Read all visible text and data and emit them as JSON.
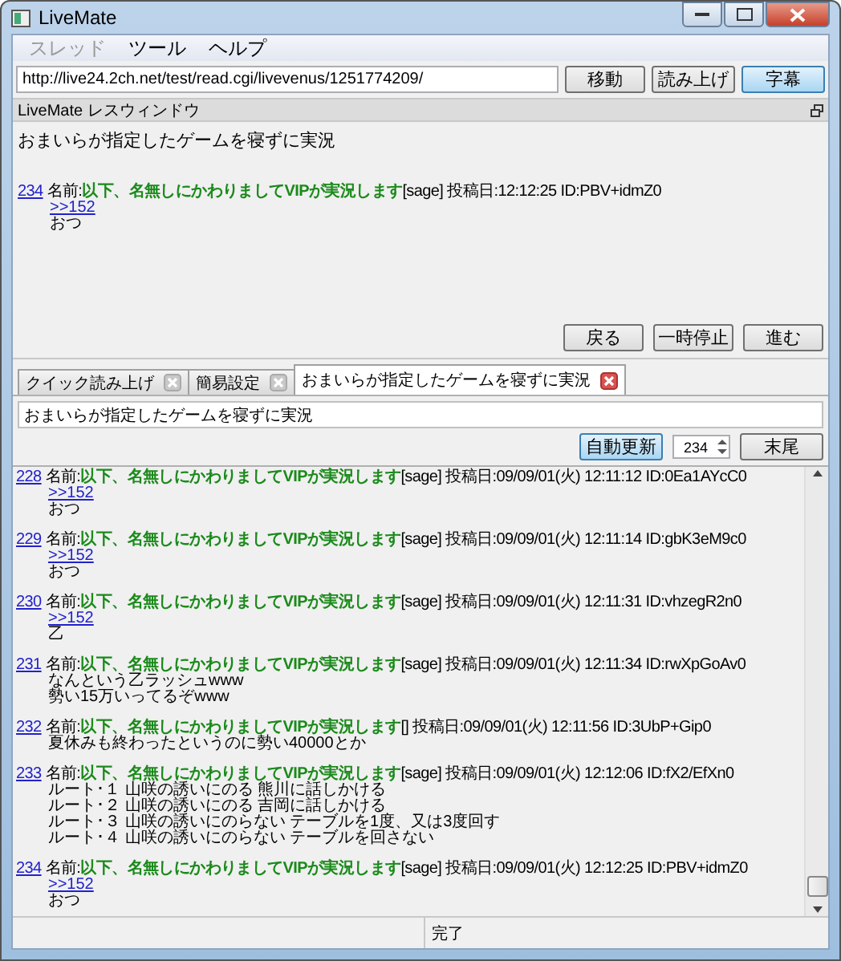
{
  "window": {
    "title": "LiveMate"
  },
  "menu": [
    {
      "label": "スレッド",
      "disabled": true
    },
    {
      "label": "ツール",
      "disabled": false
    },
    {
      "label": "ヘルプ",
      "disabled": false
    }
  ],
  "url_bar": {
    "value": "http://live24.2ch.net/test/read.cgi/livevenus/1251774209/",
    "buttons": [
      {
        "label": "移動",
        "selected": false
      },
      {
        "label": "読み上げ",
        "selected": false
      },
      {
        "label": "字幕",
        "selected": true
      }
    ]
  },
  "res_window": {
    "title": "LiveMate レスウィンドウ",
    "thread_title": "おまいらが指定したゲームを寝ずに実況",
    "post": {
      "number": "234",
      "name_label": "名前:",
      "name": "以下、名無しにかわりましてVIPが実況します",
      "mail": "[sage]",
      "date_label": "投稿日:",
      "date": "12:12:25",
      "id": "ID:PBV+idmZ0",
      "anchor": ">>152",
      "lines": [
        "おつ"
      ]
    },
    "buttons": [
      "戻る",
      "一時停止",
      "進む"
    ]
  },
  "tabs": [
    {
      "label": "クイック読み上げ",
      "selected": false
    },
    {
      "label": "簡易設定",
      "selected": false
    },
    {
      "label": "おまいらが指定したゲームを寝ずに実況",
      "selected": true
    }
  ],
  "thread": {
    "title": "おまいらが指定したゲームを寝ずに実況",
    "auto_update": {
      "label": "自動更新",
      "selected": true
    },
    "res_number": "234",
    "end_button": "末尾",
    "posts": [
      {
        "number": "228",
        "name_label": "名前:",
        "name": "以下、名無しにかわりましてVIPが実況します",
        "mail": "[sage]",
        "date_label": "投稿日:",
        "date": "09/09/01(火) 12:11:12",
        "id": "ID:0Ea1AYcC0",
        "anchor": ">>152",
        "lines": [
          "おつ"
        ]
      },
      {
        "number": "229",
        "name_label": "名前:",
        "name": "以下、名無しにかわりましてVIPが実況します",
        "mail": "[sage]",
        "date_label": "投稿日:",
        "date": "09/09/01(火) 12:11:14",
        "id": "ID:gbK3eM9c0",
        "anchor": ">>152",
        "lines": [
          "おつ"
        ]
      },
      {
        "number": "230",
        "name_label": "名前:",
        "name": "以下、名無しにかわりましてVIPが実況します",
        "mail": "[sage]",
        "date_label": "投稿日:",
        "date": "09/09/01(火) 12:11:31",
        "id": "ID:vhzegR2n0",
        "anchor": ">>152",
        "lines": [
          "乙"
        ]
      },
      {
        "number": "231",
        "name_label": "名前:",
        "name": "以下、名無しにかわりましてVIPが実況します",
        "mail": "[sage]",
        "date_label": "投稿日:",
        "date": "09/09/01(火) 12:11:34",
        "id": "ID:rwXpGoAv0",
        "lines": [
          "なんという乙ラッシュwww",
          "勢い15万いってるぞwww"
        ]
      },
      {
        "number": "232",
        "name_label": "名前:",
        "name": "以下、名無しにかわりましてVIPが実況します",
        "mail": "[]",
        "date_label": "投稿日:",
        "date": "09/09/01(火) 12:11:56",
        "id": "ID:3UbP+Gip0",
        "lines": [
          "夏休みも終わったというのに勢い40000とか"
        ]
      },
      {
        "number": "233",
        "name_label": "名前:",
        "name": "以下、名無しにかわりましてVIPが実況します",
        "mail": "[sage]",
        "date_label": "投稿日:",
        "date": "09/09/01(火) 12:12:06",
        "id": "ID:fX2/EfXn0",
        "lines": [
          "ルート･１ 山咲の誘いにのる 熊川に話しかける",
          "ルート･２ 山咲の誘いにのる 吉岡に話しかける",
          "ルート･３ 山咲の誘いにのらない テーブルを1度、又は3度回す",
          "ルート･４ 山咲の誘いにのらない テーブルを回さない"
        ]
      },
      {
        "number": "234",
        "name_label": "名前:",
        "name": "以下、名無しにかわりましてVIPが実況します",
        "mail": "[sage]",
        "date_label": "投稿日:",
        "date": "09/09/01(火) 12:12:25",
        "id": "ID:PBV+idmZ0",
        "anchor": ">>152",
        "lines": [
          "おつ"
        ]
      }
    ]
  },
  "status_bar": {
    "text": "完了"
  }
}
